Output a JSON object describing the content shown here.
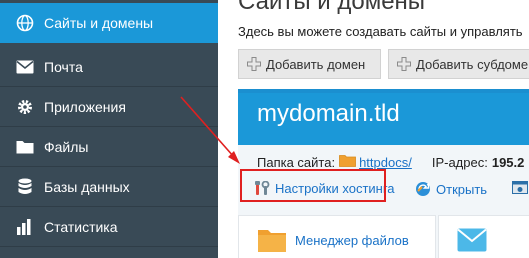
{
  "sidebar": {
    "items": [
      {
        "label": "Сайты и домены",
        "icon": "globe-icon",
        "active": true
      },
      {
        "label": "Почта",
        "icon": "mail-icon",
        "active": false
      },
      {
        "label": "Приложения",
        "icon": "gear-icon",
        "active": false
      },
      {
        "label": "Файлы",
        "icon": "folder-icon",
        "active": false
      },
      {
        "label": "Базы данных",
        "icon": "database-icon",
        "active": false
      },
      {
        "label": "Статистика",
        "icon": "chart-icon",
        "active": false
      }
    ]
  },
  "main": {
    "title": "Сайты и домены",
    "intro": "Здесь вы можете создавать сайты и управлять",
    "toolbar": {
      "add_domain": "Добавить домен",
      "add_subdomain": "Добавить субдоме"
    },
    "domain": {
      "name": "mydomain.tld",
      "folder_label": "Папка сайта:",
      "folder_link": "httpdocs/",
      "ip_label": "IP-адрес:",
      "ip_value": "195.2",
      "actions": {
        "hosting_settings": "Настройки хостинга",
        "open": "Открыть"
      },
      "apps": {
        "file_manager": "Менеджер файлов"
      }
    }
  },
  "colors": {
    "sidebar_bg": "#394a56",
    "active_item": "#1b98d8",
    "link": "#1a72c7",
    "highlight": "#e02020"
  }
}
